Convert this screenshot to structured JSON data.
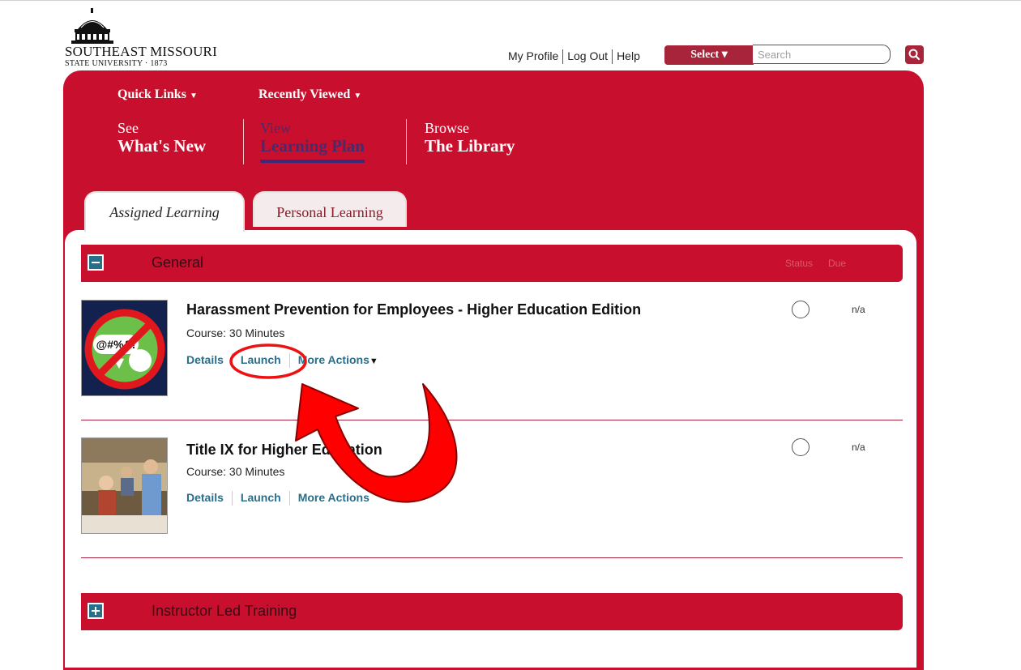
{
  "logo": {
    "line1": "SOUTHEAST MISSOURI",
    "line2": "STATE UNIVERSITY · 1873"
  },
  "header": {
    "my_profile": "My Profile",
    "log_out": "Log Out",
    "help": "Help",
    "select_label": "Select ▾",
    "search_placeholder": "Search"
  },
  "nav": {
    "quick_links": "Quick Links",
    "recently_viewed": "Recently Viewed",
    "items": [
      {
        "small": "See",
        "big": "What's New"
      },
      {
        "small": "View",
        "big": "Learning Plan"
      },
      {
        "small": "Browse",
        "big": "The Library"
      }
    ]
  },
  "tabs": {
    "assigned": "Assigned Learning",
    "personal": "Personal Learning"
  },
  "sections": {
    "general": {
      "title": "General",
      "status_header": "Status",
      "due_header": "Due"
    },
    "instructor": {
      "title": "Instructor Led Training"
    }
  },
  "courses": [
    {
      "title": "Harassment Prevention for Employees - Higher Education Edition",
      "meta": "Course: 30 Minutes",
      "details": "Details",
      "launch": "Launch",
      "more": "More Actions",
      "due": "n/a",
      "thumb_text": "@#%&!"
    },
    {
      "title": "Title IX for Higher Education",
      "meta": "Course: 30 Minutes",
      "details": "Details",
      "launch": "Launch",
      "more": "More Actions",
      "due": "n/a"
    }
  ],
  "colors": {
    "brand_red": "#c8102e",
    "link_blue": "#2a6f8a",
    "annotation_red": "#ff0000"
  }
}
